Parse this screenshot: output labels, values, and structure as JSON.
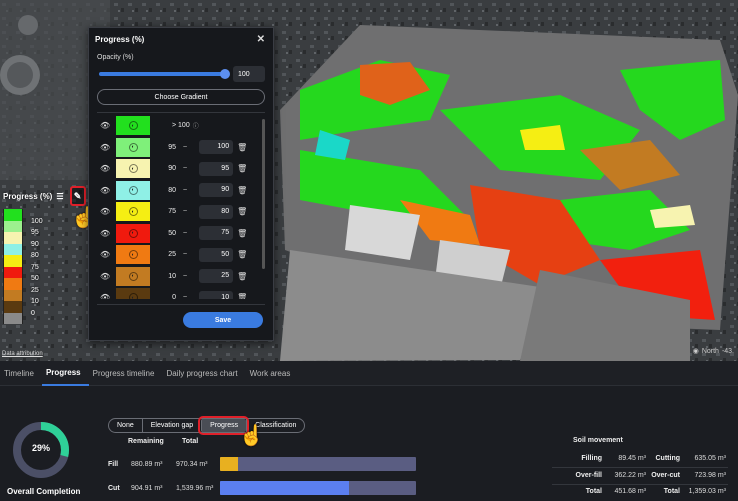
{
  "map": {
    "attribution": "Data attribution",
    "north_label": "North",
    "north_value": "-43."
  },
  "legend": {
    "title": "Progress (%)",
    "filter_icon": "filter-icon",
    "edit_icon": "pencil-icon",
    "entries": [
      {
        "label": "100",
        "color": "#22e01e"
      },
      {
        "label": "95",
        "color": "#9cf08e"
      },
      {
        "label": "90",
        "color": "#f7f3b0"
      },
      {
        "label": "80",
        "color": "#8ff0e6"
      },
      {
        "label": "75",
        "color": "#f5ee13"
      },
      {
        "label": "50",
        "color": "#f01a0e"
      },
      {
        "label": "25",
        "color": "#f07a12"
      },
      {
        "label": "10",
        "color": "#c27b22"
      },
      {
        "label": "0",
        "color": "#5a3a10"
      },
      {
        "label": "",
        "color": "#8a8a8a"
      }
    ]
  },
  "popup": {
    "title": "Progress (%)",
    "close_icon": "close-icon",
    "opacity_label": "Opacity (%)",
    "opacity_value": "100",
    "opacity_fraction": 1.0,
    "gradient_button": "Choose Gradient",
    "top_row": {
      "label": "> 100",
      "color": "#22e01e"
    },
    "rows": [
      {
        "low": "95",
        "sep": "~",
        "high": "100",
        "color": "#7ff07a"
      },
      {
        "low": "90",
        "sep": "~",
        "high": "95",
        "color": "#f7f3b0"
      },
      {
        "low": "80",
        "sep": "~",
        "high": "90",
        "color": "#8ff0e6"
      },
      {
        "low": "75",
        "sep": "~",
        "high": "80",
        "color": "#f5ee13"
      },
      {
        "low": "50",
        "sep": "~",
        "high": "75",
        "color": "#f01a0e"
      },
      {
        "low": "25",
        "sep": "~",
        "high": "50",
        "color": "#f07a12"
      },
      {
        "low": "10",
        "sep": "~",
        "high": "25",
        "color": "#c27b22"
      },
      {
        "low": "0",
        "sep": "~",
        "high": "10",
        "color": "#5a3a10"
      }
    ],
    "save_button": "Save"
  },
  "tabs": [
    {
      "label": "Timeline",
      "active": false
    },
    {
      "label": "Progress",
      "active": true
    },
    {
      "label": "Progress timeline",
      "active": false
    },
    {
      "label": "Daily progress chart",
      "active": false
    },
    {
      "label": "Work areas",
      "active": false
    }
  ],
  "summary": {
    "overall_percent": "29%",
    "overall_fraction": 0.29,
    "overall_label": "Overall Completion",
    "segments": [
      "None",
      "Elevation gap",
      "Progress",
      "Classification"
    ],
    "selected_segment": "Progress",
    "col_remaining": "Remaining",
    "col_total": "Total",
    "fill": {
      "label": "Fill",
      "remaining": "880.89 m³",
      "total": "970.34 m³",
      "fraction": 0.092,
      "color": "#e8b020"
    },
    "cut": {
      "label": "Cut",
      "remaining": "904.91 m³",
      "total": "1,539.96 m³",
      "fraction": 0.659,
      "color": "#5b7ff0"
    },
    "soil": {
      "title": "Soil movement",
      "filling_label": "Filling",
      "filling": "89.45 m³",
      "cutting_label": "Cutting",
      "cutting": "635.05 m³",
      "overfill_label": "Over-fill",
      "overfill": "362.22 m³",
      "overcut_label": "Over-cut",
      "overcut": "723.98 m³",
      "total_label_1": "Total",
      "total_1": "451.68 m³",
      "total_label_2": "Total",
      "total_2": "1,359.03 m³"
    }
  }
}
